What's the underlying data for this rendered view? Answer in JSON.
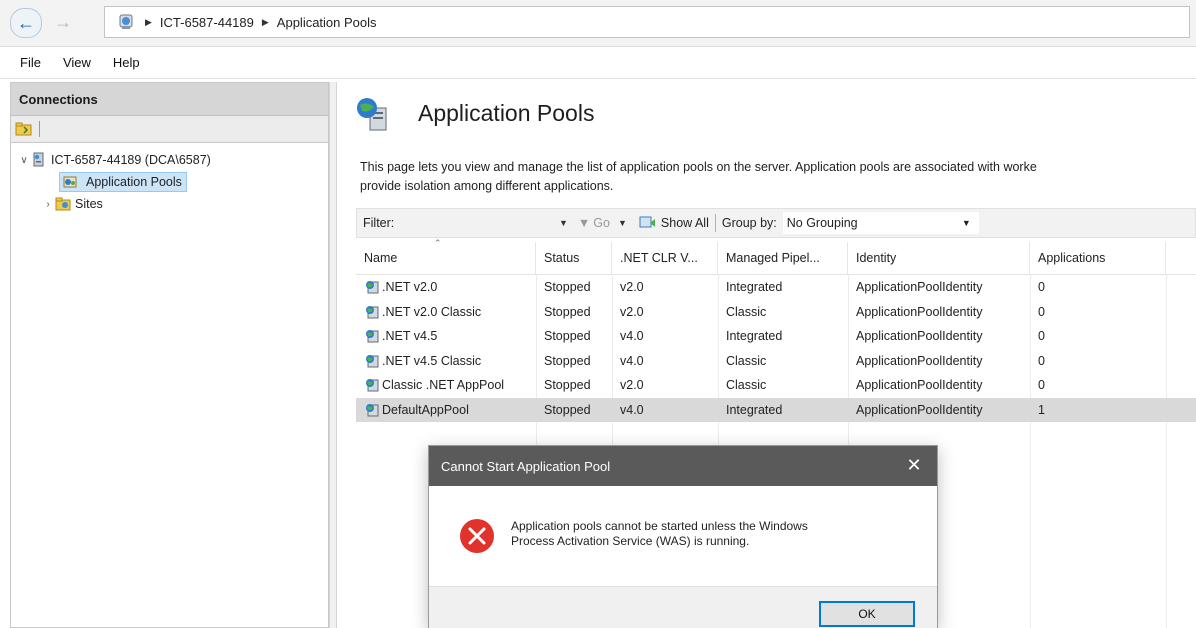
{
  "address_bar": {
    "breadcrumbs": [
      "ICT-6587-44189",
      "Application Pools"
    ],
    "back_icon": "arrow-left-icon",
    "forward_icon": "arrow-right-icon",
    "home_icon": "iis-server-icon"
  },
  "menubar": {
    "items": [
      "File",
      "View",
      "Help"
    ]
  },
  "connections": {
    "header": "Connections",
    "tree": {
      "server": "ICT-6587-44189 (DCA\\6587)",
      "pools": "Application Pools",
      "sites": "Sites"
    }
  },
  "main": {
    "title": "Application Pools",
    "description_line1": "This page lets you view and manage the list of application pools on the server. Application pools are associated with worke",
    "description_line2": "provide isolation among different applications.",
    "filter": {
      "label": "Filter:",
      "value": "",
      "go_label": "Go",
      "show_all_label": "Show All",
      "group_by_label": "Group by:",
      "group_by_value": "No Grouping"
    },
    "table": {
      "columns": [
        "Name",
        "Status",
        ".NET CLR V...",
        "Managed Pipel...",
        "Identity",
        "Applications"
      ],
      "rows": [
        {
          "name": ".NET v2.0",
          "status": "Stopped",
          "clr": "v2.0",
          "pipeline": "Integrated",
          "identity": "ApplicationPoolIdentity",
          "apps": "0"
        },
        {
          "name": ".NET v2.0 Classic",
          "status": "Stopped",
          "clr": "v2.0",
          "pipeline": "Classic",
          "identity": "ApplicationPoolIdentity",
          "apps": "0"
        },
        {
          "name": ".NET v4.5",
          "status": "Stopped",
          "clr": "v4.0",
          "pipeline": "Integrated",
          "identity": "ApplicationPoolIdentity",
          "apps": "0"
        },
        {
          "name": ".NET v4.5 Classic",
          "status": "Stopped",
          "clr": "v4.0",
          "pipeline": "Classic",
          "identity": "ApplicationPoolIdentity",
          "apps": "0"
        },
        {
          "name": "Classic .NET AppPool",
          "status": "Stopped",
          "clr": "v2.0",
          "pipeline": "Classic",
          "identity": "ApplicationPoolIdentity",
          "apps": "0"
        },
        {
          "name": "DefaultAppPool",
          "status": "Stopped",
          "clr": "v4.0",
          "pipeline": "Integrated",
          "identity": "ApplicationPoolIdentity",
          "apps": "1"
        }
      ],
      "selected_row": 5
    }
  },
  "dialog": {
    "title": "Cannot Start Application Pool",
    "message_line1": "Application pools cannot be started unless the Windows",
    "message_line2": "Process Activation Service (WAS) is running.",
    "ok_label": "OK",
    "icon": "error-icon",
    "close_icon": "close-icon"
  },
  "colors": {
    "dialog_title_bar": "#5a5a5a",
    "error_red": "#e0332b",
    "selection": "#cce4f7",
    "ok_button_border": "#0078d7"
  }
}
